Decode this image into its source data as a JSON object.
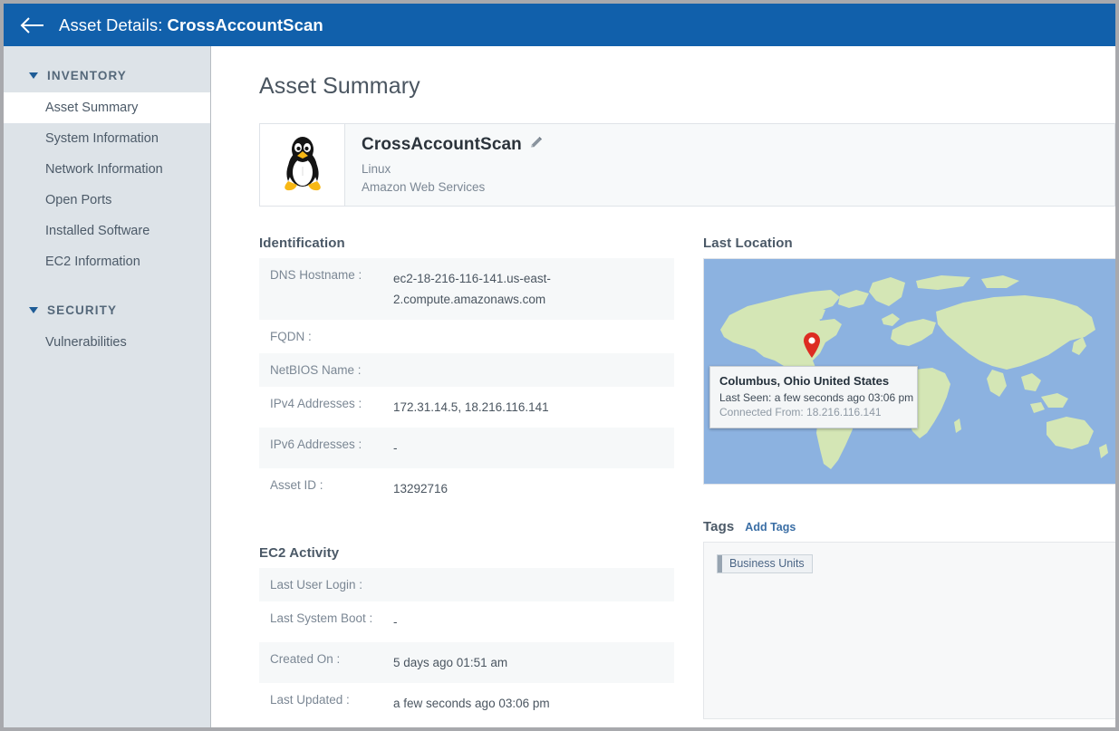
{
  "header": {
    "back_icon": "arrow-left-icon",
    "prefix": "Asset Details:",
    "asset_name": "CrossAccountScan",
    "bg_color": "#1160ab"
  },
  "sidebar": {
    "groups": [
      {
        "label": "INVENTORY",
        "items": [
          {
            "label": "Asset Summary",
            "active": true
          },
          {
            "label": "System Information",
            "active": false
          },
          {
            "label": "Network Information",
            "active": false
          },
          {
            "label": "Open Ports",
            "active": false
          },
          {
            "label": "Installed Software",
            "active": false
          },
          {
            "label": "EC2 Information",
            "active": false
          }
        ]
      },
      {
        "label": "SECURITY",
        "items": [
          {
            "label": "Vulnerabilities",
            "active": false
          }
        ]
      }
    ]
  },
  "main": {
    "page_title": "Asset Summary",
    "asset_card": {
      "logo_icon": "linux-penguin-icon",
      "name": "CrossAccountScan",
      "edit_icon": "pencil-edit-icon",
      "os": "Linux",
      "provider": "Amazon Web Services"
    },
    "identification": {
      "title": "Identification",
      "rows": [
        {
          "key": "DNS Hostname :",
          "value": "ec2-18-216-116-141.us-east-2.compute.amazonaws.com"
        },
        {
          "key": "FQDN :",
          "value": ""
        },
        {
          "key": "NetBIOS Name :",
          "value": ""
        },
        {
          "key": "IPv4 Addresses :",
          "value": "172.31.14.5, 18.216.116.141"
        },
        {
          "key": "IPv6 Addresses :",
          "value": "-"
        },
        {
          "key": "Asset ID :",
          "value": "13292716"
        }
      ]
    },
    "ec2_activity": {
      "title": "EC2 Activity",
      "rows": [
        {
          "key": "Last User Login :",
          "value": ""
        },
        {
          "key": "Last System Boot :",
          "value": "-"
        },
        {
          "key": "Created On :",
          "value": "5 days ago 01:51 am"
        },
        {
          "key": "Last Updated :",
          "value": "a few seconds ago 03:06 pm"
        }
      ]
    },
    "last_location": {
      "title": "Last Location",
      "pin_icon": "map-pin-icon",
      "tooltip": {
        "place": "Columbus, Ohio United States",
        "last_seen": "Last Seen: a few seconds ago 03:06 pm",
        "connected_from": "Connected From: 18.216.116.141"
      },
      "map_colors": {
        "ocean": "#8cb2e0",
        "land": "#d4e6b5",
        "pin": "#dd2c22"
      }
    },
    "tags": {
      "title": "Tags",
      "add_link": "Add Tags",
      "items": [
        {
          "label": "Business Units"
        }
      ]
    }
  }
}
